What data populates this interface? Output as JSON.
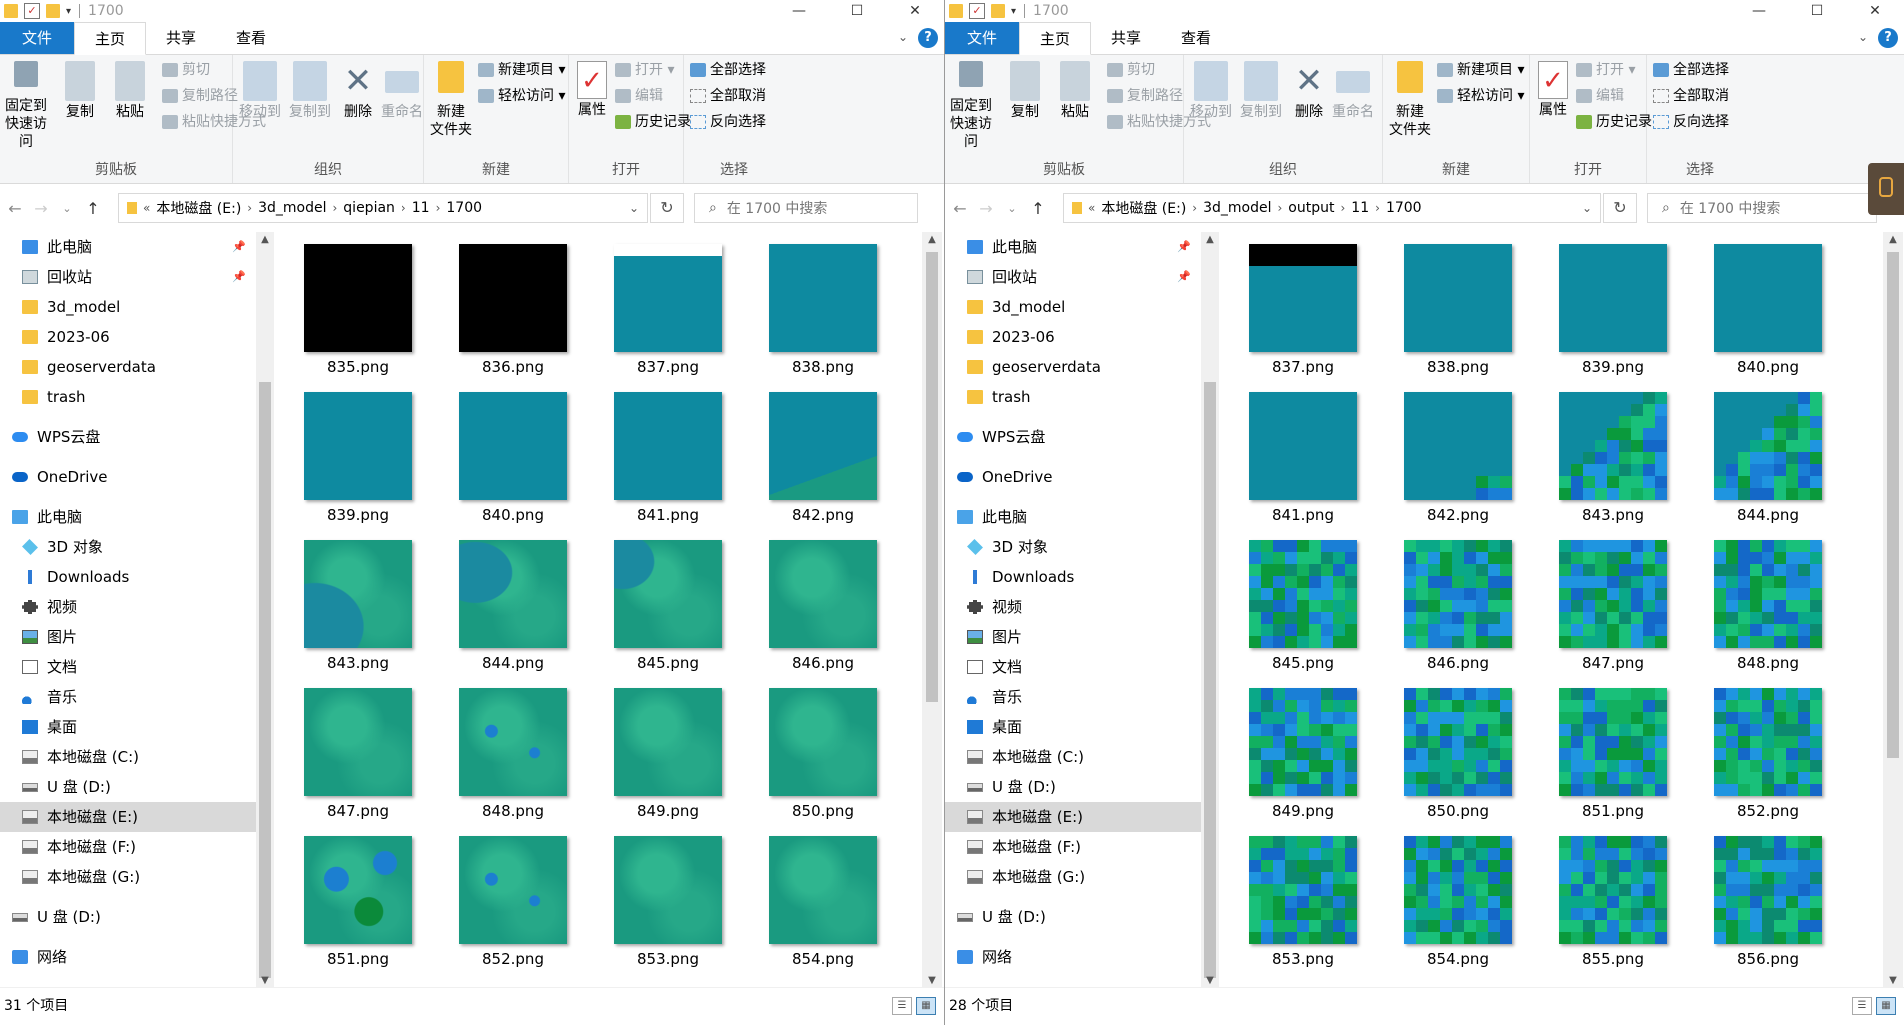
{
  "windows": [
    {
      "title": "1700",
      "tabs": [
        "文件",
        "主页",
        "共享",
        "查看"
      ],
      "active_tab": "主页",
      "ribbon": {
        "clipboard": {
          "label": "剪贴板",
          "pin": "固定到\n快速访问",
          "copy": "复制",
          "paste": "粘贴",
          "cut": "剪切",
          "copy_path": "复制路径",
          "paste_shortcut": "粘贴快捷方式"
        },
        "organize": {
          "label": "组织",
          "move_to": "移动到",
          "copy_to": "复制到",
          "delete": "删除",
          "rename": "重命名"
        },
        "new": {
          "label": "新建",
          "new_folder": "新建\n文件夹",
          "new_item": "新建项目",
          "easy_access": "轻松访问"
        },
        "open": {
          "label": "打开",
          "properties": "属性",
          "open": "打开",
          "edit": "编辑",
          "history": "历史记录"
        },
        "select": {
          "label": "选择",
          "select_all": "全部选择",
          "select_none": "全部取消",
          "invert": "反向选择"
        }
      },
      "breadcrumbs": [
        "本地磁盘 (E:)",
        "3d_model",
        "qiepian",
        "11",
        "1700"
      ],
      "search_placeholder": "在 1700 中搜索",
      "nav": [
        {
          "label": "此电脑",
          "icon": "desktop-icon",
          "pinned": true
        },
        {
          "label": "回收站",
          "icon": "recycle-bin-icon",
          "pinned": true
        },
        {
          "label": "3d_model",
          "icon": "folder-icon"
        },
        {
          "label": "2023-06",
          "icon": "folder-icon"
        },
        {
          "label": "geoserverdata",
          "icon": "folder-icon"
        },
        {
          "label": "trash",
          "icon": "folder-icon"
        },
        {
          "label": "WPS云盘",
          "icon": "cloud-icon",
          "top": true
        },
        {
          "label": "OneDrive",
          "icon": "onedrive-icon",
          "top": true
        },
        {
          "label": "此电脑",
          "icon": "computer-icon",
          "top": true
        },
        {
          "label": "3D 对象",
          "icon": "3d-objects-icon"
        },
        {
          "label": "Downloads",
          "icon": "download-icon"
        },
        {
          "label": "视频",
          "icon": "video-icon"
        },
        {
          "label": "图片",
          "icon": "pictures-icon"
        },
        {
          "label": "文档",
          "icon": "documents-icon"
        },
        {
          "label": "音乐",
          "icon": "music-icon"
        },
        {
          "label": "桌面",
          "icon": "desktop-folder-icon"
        },
        {
          "label": "本地磁盘 (C:)",
          "icon": "drive-icon"
        },
        {
          "label": "U 盘 (D:)",
          "icon": "usb-drive-icon"
        },
        {
          "label": "本地磁盘 (E:)",
          "icon": "drive-icon",
          "selected": true
        },
        {
          "label": "本地磁盘 (F:)",
          "icon": "drive-icon"
        },
        {
          "label": "本地磁盘 (G:)",
          "icon": "drive-icon"
        },
        {
          "label": "U 盘 (D:)",
          "icon": "usb-drive-icon",
          "top": true
        },
        {
          "label": "网络",
          "icon": "network-icon",
          "top": true
        }
      ],
      "files": [
        {
          "name": "835.png",
          "thumb": "black"
        },
        {
          "name": "836.png",
          "thumb": "black"
        },
        {
          "name": "837.png",
          "thumb": "teal-whitetop"
        },
        {
          "name": "838.png",
          "thumb": "teal"
        },
        {
          "name": "839.png",
          "thumb": "teal"
        },
        {
          "name": "840.png",
          "thumb": "teal"
        },
        {
          "name": "841.png",
          "thumb": "teal"
        },
        {
          "name": "842.png",
          "thumb": "teal-landcorner"
        },
        {
          "name": "843.png",
          "thumb": "terrain-coast"
        },
        {
          "name": "844.png",
          "thumb": "terrain-coast2"
        },
        {
          "name": "845.png",
          "thumb": "terrain-coast3"
        },
        {
          "name": "846.png",
          "thumb": "terrain"
        },
        {
          "name": "847.png",
          "thumb": "terrain"
        },
        {
          "name": "848.png",
          "thumb": "terrain-blue"
        },
        {
          "name": "849.png",
          "thumb": "terrain"
        },
        {
          "name": "850.png",
          "thumb": "terrain"
        },
        {
          "name": "851.png",
          "thumb": "terrain-blue2"
        },
        {
          "name": "852.png",
          "thumb": "terrain-blue"
        },
        {
          "name": "853.png",
          "thumb": "terrain"
        },
        {
          "name": "854.png",
          "thumb": "terrain"
        }
      ],
      "status": "31 个项目"
    },
    {
      "title": "1700",
      "tabs": [
        "文件",
        "主页",
        "共享",
        "查看"
      ],
      "active_tab": "主页",
      "ribbon": {
        "clipboard": {
          "label": "剪贴板",
          "pin": "固定到\n快速访问",
          "copy": "复制",
          "paste": "粘贴",
          "cut": "剪切",
          "copy_path": "复制路径",
          "paste_shortcut": "粘贴快捷方式"
        },
        "organize": {
          "label": "组织",
          "move_to": "移动到",
          "copy_to": "复制到",
          "delete": "删除",
          "rename": "重命名"
        },
        "new": {
          "label": "新建",
          "new_folder": "新建\n文件夹",
          "new_item": "新建项目",
          "easy_access": "轻松访问"
        },
        "open": {
          "label": "打开",
          "properties": "属性",
          "open": "打开",
          "edit": "编辑",
          "history": "历史记录"
        },
        "select": {
          "label": "选择",
          "select_all": "全部选择",
          "select_none": "全部取消",
          "invert": "反向选择"
        }
      },
      "breadcrumbs": [
        "本地磁盘 (E:)",
        "3d_model",
        "output",
        "11",
        "1700"
      ],
      "search_placeholder": "在 1700 中搜索",
      "nav": [
        {
          "label": "此电脑",
          "icon": "desktop-icon",
          "pinned": true
        },
        {
          "label": "回收站",
          "icon": "recycle-bin-icon",
          "pinned": true
        },
        {
          "label": "3d_model",
          "icon": "folder-icon"
        },
        {
          "label": "2023-06",
          "icon": "folder-icon"
        },
        {
          "label": "geoserverdata",
          "icon": "folder-icon"
        },
        {
          "label": "trash",
          "icon": "folder-icon"
        },
        {
          "label": "WPS云盘",
          "icon": "cloud-icon",
          "top": true
        },
        {
          "label": "OneDrive",
          "icon": "onedrive-icon",
          "top": true
        },
        {
          "label": "此电脑",
          "icon": "computer-icon",
          "top": true
        },
        {
          "label": "3D 对象",
          "icon": "3d-objects-icon"
        },
        {
          "label": "Downloads",
          "icon": "download-icon"
        },
        {
          "label": "视频",
          "icon": "video-icon"
        },
        {
          "label": "图片",
          "icon": "pictures-icon"
        },
        {
          "label": "文档",
          "icon": "documents-icon"
        },
        {
          "label": "音乐",
          "icon": "music-icon"
        },
        {
          "label": "桌面",
          "icon": "desktop-folder-icon"
        },
        {
          "label": "本地磁盘 (C:)",
          "icon": "drive-icon"
        },
        {
          "label": "U 盘 (D:)",
          "icon": "usb-drive-icon"
        },
        {
          "label": "本地磁盘 (E:)",
          "icon": "drive-icon",
          "selected": true
        },
        {
          "label": "本地磁盘 (F:)",
          "icon": "drive-icon"
        },
        {
          "label": "本地磁盘 (G:)",
          "icon": "drive-icon"
        },
        {
          "label": "U 盘 (D:)",
          "icon": "usb-drive-icon",
          "top": true
        },
        {
          "label": "网络",
          "icon": "network-icon",
          "top": true
        }
      ],
      "files": [
        {
          "name": "837.png",
          "thumb": "teal-blacktop"
        },
        {
          "name": "838.png",
          "thumb": "teal"
        },
        {
          "name": "839.png",
          "thumb": "teal"
        },
        {
          "name": "840.png",
          "thumb": "teal"
        },
        {
          "name": "841.png",
          "thumb": "teal"
        },
        {
          "name": "842.png",
          "thumb": "pixel-corner"
        },
        {
          "name": "843.png",
          "thumb": "pixel-half"
        },
        {
          "name": "844.png",
          "thumb": "pixel-half"
        },
        {
          "name": "845.png",
          "thumb": "pixel"
        },
        {
          "name": "846.png",
          "thumb": "pixel"
        },
        {
          "name": "847.png",
          "thumb": "pixel"
        },
        {
          "name": "848.png",
          "thumb": "pixel"
        },
        {
          "name": "849.png",
          "thumb": "pixel"
        },
        {
          "name": "850.png",
          "thumb": "pixel"
        },
        {
          "name": "851.png",
          "thumb": "pixel"
        },
        {
          "name": "852.png",
          "thumb": "pixel"
        },
        {
          "name": "853.png",
          "thumb": "pixel"
        },
        {
          "name": "854.png",
          "thumb": "pixel"
        },
        {
          "name": "855.png",
          "thumb": "pixel"
        },
        {
          "name": "856.png",
          "thumb": "pixel"
        }
      ],
      "status": "28 个项目"
    }
  ],
  "colors": {
    "accent": "#1979ca",
    "teal": "#0e8aa0",
    "selected": "#d9d9d9"
  }
}
